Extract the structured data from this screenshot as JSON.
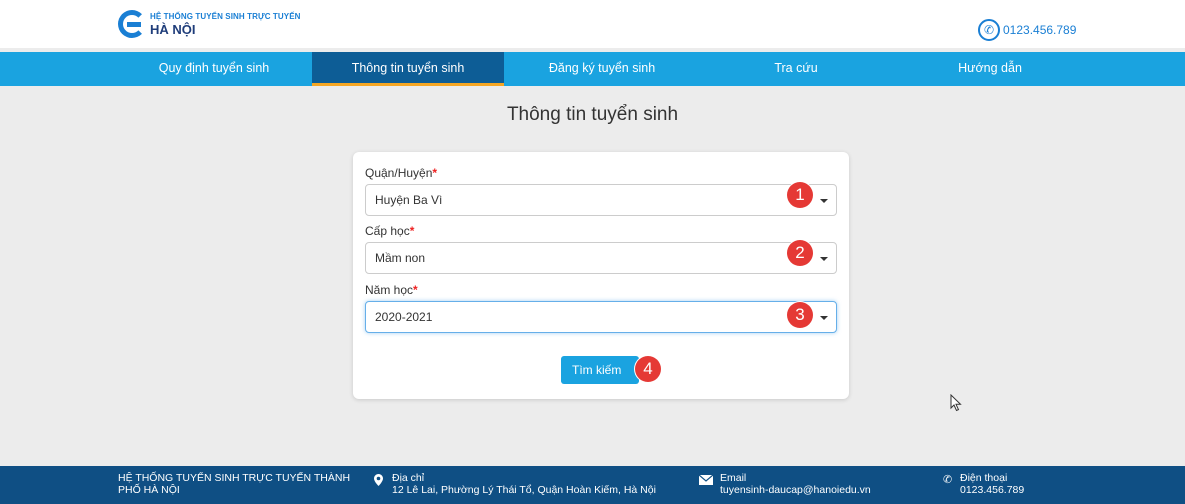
{
  "header": {
    "logo_line1": "HỆ THỐNG TUYỂN SINH TRỰC TUYẾN",
    "logo_line2": "HÀ NỘI",
    "phone": "0123.456.789"
  },
  "nav": {
    "items": [
      {
        "label": "Quy định tuyển sinh"
      },
      {
        "label": "Thông tin tuyển sinh"
      },
      {
        "label": "Đăng ký tuyển sinh"
      },
      {
        "label": "Tra cứu"
      },
      {
        "label": "Hướng dẫn"
      }
    ],
    "active_index": 1
  },
  "main": {
    "title": "Thông tin tuyển sinh",
    "form": {
      "district": {
        "label": "Quận/Huyện",
        "required_mark": "*",
        "value": "Huyện Ba Vì",
        "badge": "1"
      },
      "level": {
        "label": "Cấp học",
        "required_mark": "*",
        "value": "Mầm non",
        "badge": "2"
      },
      "year": {
        "label": "Năm học",
        "required_mark": "*",
        "value": "2020-2021",
        "badge": "3"
      },
      "search_button": {
        "label": "Tìm kiếm",
        "badge": "4"
      }
    }
  },
  "footer": {
    "org_line1": "HỆ THỐNG TUYỂN SINH TRỰC TUYẾN THÀNH",
    "org_line2": "PHỐ HÀ NỘI",
    "address_label": "Địa chỉ",
    "address_value": "12 Lê Lai, Phường Lý Thái Tổ, Quận Hoàn Kiếm, Hà Nội",
    "email_label": "Email",
    "email_value": "tuyensinh-daucap@hanoiedu.vn",
    "phone_label": "Điện thoại",
    "phone_value": "0123.456.789"
  },
  "colors": {
    "nav_bg": "#1aa3e0",
    "nav_active_bg": "#0d5d96",
    "nav_active_underline": "#f5a623",
    "badge": "#e53935",
    "footer_bg": "#0f4f84"
  },
  "icons": [
    "phone-icon",
    "map-pin-icon",
    "envelope-icon",
    "mouse-cursor-icon",
    "caret-down-icon"
  ]
}
